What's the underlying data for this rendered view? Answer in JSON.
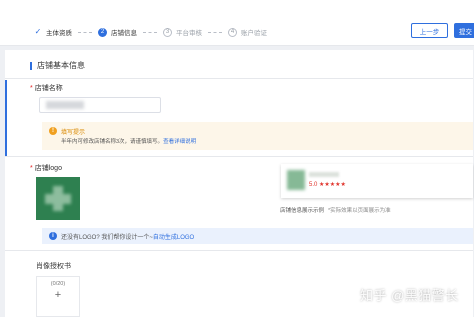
{
  "stepper": {
    "steps": [
      {
        "mark": "✓",
        "label": "主体资质",
        "state": "done"
      },
      {
        "mark": "2",
        "label": "店铺信息",
        "state": "active"
      },
      {
        "mark": "3",
        "label": "平台审核",
        "state": "todo"
      },
      {
        "mark": "4",
        "label": "账户验证",
        "state": "todo"
      }
    ]
  },
  "header_buttons": {
    "prev_label": "上一步",
    "submit_label": "提交"
  },
  "section": {
    "title": "店铺基本信息"
  },
  "store_name": {
    "required_mark": "*",
    "label": "店铺名称",
    "value": ""
  },
  "warning_notice": {
    "icon": "warning-icon",
    "title": "填写提示",
    "text": "半年内可修改店铺名称3次，请谨慎填写。",
    "link": "查看详细说明"
  },
  "store_logo": {
    "required_mark": "*",
    "label": "店铺logo"
  },
  "preview": {
    "rating": "5.0 ★★★★★",
    "caption": "店铺信息展示示例",
    "caption_note": "*实际效果以页面展示为准"
  },
  "info_notice": {
    "icon": "info-icon",
    "text": "还没有LOGO? 我们帮你设计一个~",
    "link": "自动生成LOGO"
  },
  "authorization": {
    "label": "肖像授权书",
    "upload_count": "0/20",
    "upload_plus": "+"
  },
  "watermark": {
    "text": "知乎 @黑猫警长"
  },
  "colors": {
    "accent": "#2f6fde",
    "warning": "#f0a020",
    "logo_green": "#2e8050",
    "rating_red": "#e0342c"
  }
}
